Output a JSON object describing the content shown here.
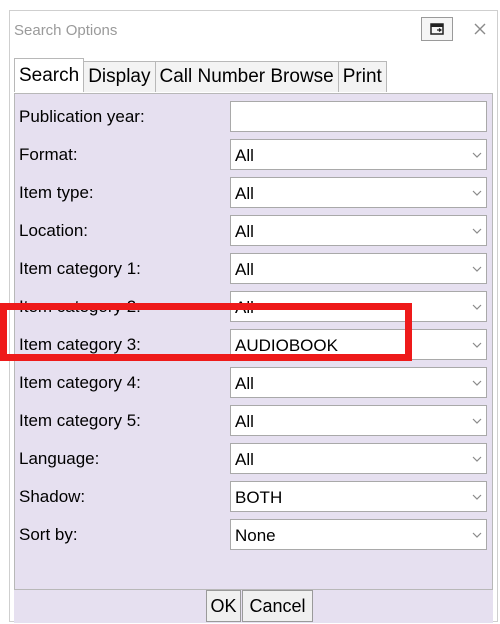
{
  "window": {
    "title": "Search Options"
  },
  "tabs": [
    {
      "label": "Search",
      "active": true
    },
    {
      "label": "Display",
      "active": false
    },
    {
      "label": "Call Number Browse",
      "active": false
    },
    {
      "label": "Print",
      "active": false
    }
  ],
  "fields": [
    {
      "label": "Publication year:",
      "value": "",
      "type": "text"
    },
    {
      "label": "Format:",
      "value": "All",
      "type": "select"
    },
    {
      "label": "Item type:",
      "value": "All",
      "type": "select"
    },
    {
      "label": "Location:",
      "value": "All",
      "type": "select"
    },
    {
      "label": "Item category 1:",
      "value": "All",
      "type": "select"
    },
    {
      "label": "Item category 2:",
      "value": "All",
      "type": "select"
    },
    {
      "label": "Item category 3:",
      "value": "AUDIOBOOK",
      "type": "select"
    },
    {
      "label": "Item category 4:",
      "value": "All",
      "type": "select"
    },
    {
      "label": "Item category 5:",
      "value": "All",
      "type": "select"
    },
    {
      "label": "Language:",
      "value": "All",
      "type": "select"
    },
    {
      "label": "Shadow:",
      "value": "BOTH",
      "type": "select"
    },
    {
      "label": "Sort by:",
      "value": "None",
      "type": "select"
    }
  ],
  "buttons": {
    "ok": "OK",
    "cancel": "Cancel"
  },
  "icons": {
    "restore": "restore-window-icon",
    "close": "close-icon",
    "dropdown": "chevron-down-icon"
  },
  "colors": {
    "panel_bg": "#e6e0f0",
    "highlight": "#ee1a1a"
  }
}
